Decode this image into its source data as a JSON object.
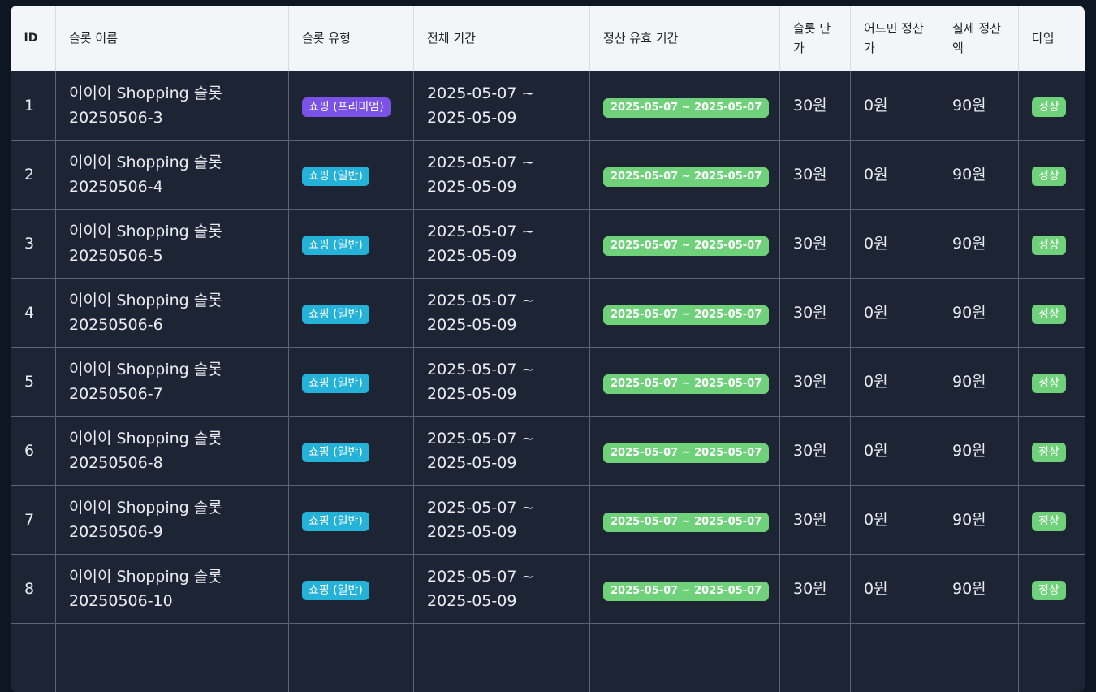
{
  "table": {
    "headers": [
      "ID",
      "슬롯 이름",
      "슬롯 유형",
      "전체 기간",
      "정산 유효 기간",
      "슬롯 단가",
      "어드민 정산가",
      "실제 정산액",
      "타입"
    ],
    "rows": [
      {
        "id": "1",
        "name_line1": "이이이 Shopping 슬롯",
        "name_line2": "20250506-3",
        "type": "쇼핑 (프리미엄)",
        "type_kind": "premium",
        "period_line1": "2025-05-07 ~",
        "period_line2": "2025-05-09",
        "valid": "2025-05-07 ~ 2025-05-07",
        "unit": "30원",
        "admin": "0원",
        "actual": "90원",
        "status": "정상"
      },
      {
        "id": "2",
        "name_line1": "이이이 Shopping 슬롯",
        "name_line2": "20250506-4",
        "type": "쇼핑 (일반)",
        "type_kind": "normal",
        "period_line1": "2025-05-07 ~",
        "period_line2": "2025-05-09",
        "valid": "2025-05-07 ~ 2025-05-07",
        "unit": "30원",
        "admin": "0원",
        "actual": "90원",
        "status": "정상"
      },
      {
        "id": "3",
        "name_line1": "이이이 Shopping 슬롯",
        "name_line2": "20250506-5",
        "type": "쇼핑 (일반)",
        "type_kind": "normal",
        "period_line1": "2025-05-07 ~",
        "period_line2": "2025-05-09",
        "valid": "2025-05-07 ~ 2025-05-07",
        "unit": "30원",
        "admin": "0원",
        "actual": "90원",
        "status": "정상"
      },
      {
        "id": "4",
        "name_line1": "이이이 Shopping 슬롯",
        "name_line2": "20250506-6",
        "type": "쇼핑 (일반)",
        "type_kind": "normal",
        "period_line1": "2025-05-07 ~",
        "period_line2": "2025-05-09",
        "valid": "2025-05-07 ~ 2025-05-07",
        "unit": "30원",
        "admin": "0원",
        "actual": "90원",
        "status": "정상"
      },
      {
        "id": "5",
        "name_line1": "이이이 Shopping 슬롯",
        "name_line2": "20250506-7",
        "type": "쇼핑 (일반)",
        "type_kind": "normal",
        "period_line1": "2025-05-07 ~",
        "period_line2": "2025-05-09",
        "valid": "2025-05-07 ~ 2025-05-07",
        "unit": "30원",
        "admin": "0원",
        "actual": "90원",
        "status": "정상"
      },
      {
        "id": "6",
        "name_line1": "이이이 Shopping 슬롯",
        "name_line2": "20250506-8",
        "type": "쇼핑 (일반)",
        "type_kind": "normal",
        "period_line1": "2025-05-07 ~",
        "period_line2": "2025-05-09",
        "valid": "2025-05-07 ~ 2025-05-07",
        "unit": "30원",
        "admin": "0원",
        "actual": "90원",
        "status": "정상"
      },
      {
        "id": "7",
        "name_line1": "이이이 Shopping 슬롯",
        "name_line2": "20250506-9",
        "type": "쇼핑 (일반)",
        "type_kind": "normal",
        "period_line1": "2025-05-07 ~",
        "period_line2": "2025-05-09",
        "valid": "2025-05-07 ~ 2025-05-07",
        "unit": "30원",
        "admin": "0원",
        "actual": "90원",
        "status": "정상"
      },
      {
        "id": "8",
        "name_line1": "이이이 Shopping 슬롯",
        "name_line2": "20250506-10",
        "type": "쇼핑 (일반)",
        "type_kind": "normal",
        "period_line1": "2025-05-07 ~",
        "period_line2": "2025-05-09",
        "valid": "2025-05-07 ~ 2025-05-07",
        "unit": "30원",
        "admin": "0원",
        "actual": "90원",
        "status": "정상"
      }
    ]
  },
  "colors": {
    "page_bg": "#0f1623",
    "row_bg": "#1d2535",
    "header_bg": "#f3f6f9",
    "premium_badge": "#7a52e6",
    "normal_badge": "#25b2d8",
    "success_badge": "#6fd27b"
  }
}
